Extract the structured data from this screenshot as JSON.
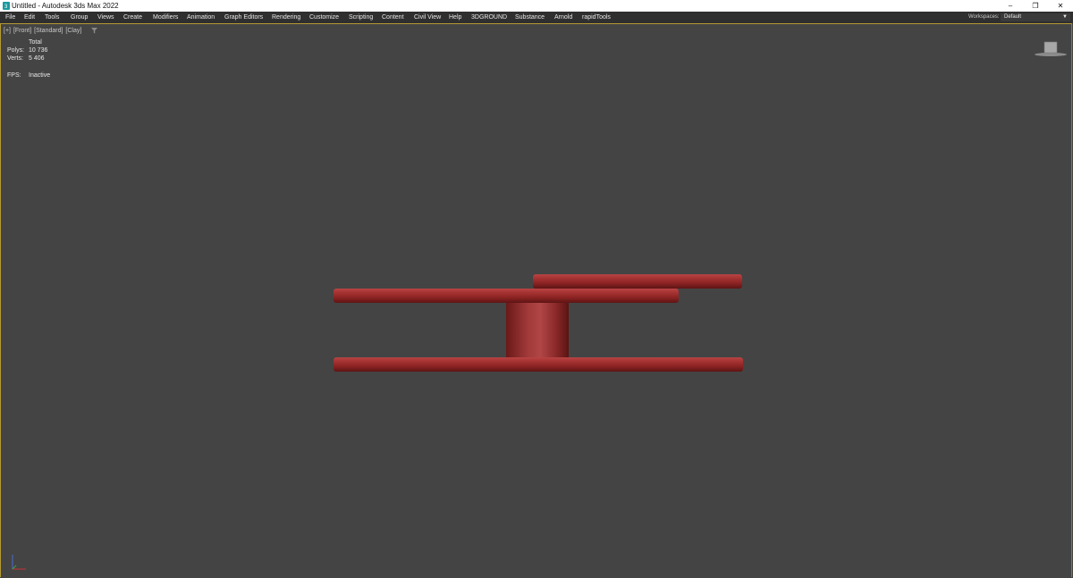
{
  "window": {
    "title": "Untitled - Autodesk 3ds Max 2022",
    "controls": {
      "minimize": "–",
      "restore": "❐",
      "close": "✕"
    }
  },
  "menubar": {
    "items": [
      "File",
      "Edit",
      "Tools",
      "Group",
      "Views",
      "Create",
      "Modifiers",
      "Animation",
      "Graph Editors",
      "Rendering",
      "Customize",
      "Scripting",
      "Content",
      "Civil View",
      "Help",
      "3DGROUND",
      "Substance",
      "Arnold",
      "rapidTools"
    ],
    "workspaces_label": "Workspaces:",
    "workspaces_value": "Default"
  },
  "viewport": {
    "label_parts": [
      "[+]",
      "[Front]",
      "[Standard]",
      "[Clay]"
    ],
    "stats": {
      "total_label": "Total",
      "polys_label": "Polys:",
      "polys_value": "10 736",
      "verts_label": "Verts:",
      "verts_value": "5 406",
      "fps_label": "FPS:",
      "fps_value": "Inactive"
    }
  },
  "colors": {
    "viewport_bg": "#444444",
    "active_border": "#b59a33",
    "clay_red": "#9b2a2a",
    "menubar_bg": "#2f2f2f"
  },
  "icons": {
    "app": "3dsmax-app-icon",
    "filter": "filter-icon",
    "viewcube": "viewcube-icon",
    "axis": "axis-tripod-icon"
  }
}
